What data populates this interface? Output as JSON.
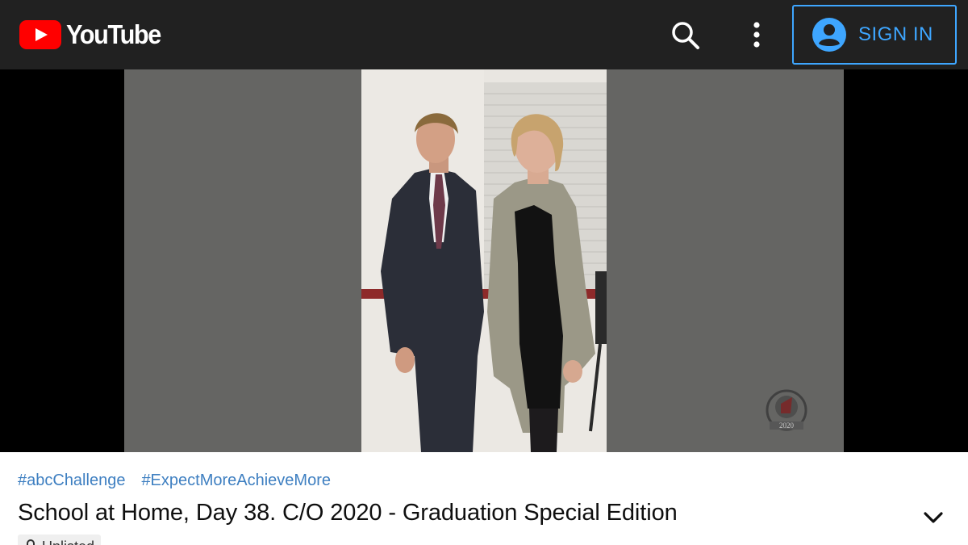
{
  "header": {
    "logo_text": "YouTube",
    "sign_in_label": "SIGN IN",
    "icons": [
      "youtube-logo-icon",
      "search-icon",
      "more-vert-icon",
      "account-circle-icon"
    ],
    "colors": {
      "bar": "#212121",
      "brand": "#ff0000",
      "sign_in": "#3ea6ff"
    }
  },
  "video": {
    "hashtags": [
      "#abcChallenge",
      "#ExpectMoreAchieveMore"
    ],
    "title": "School at Home, Day 38. C/O 2020 - Graduation Special Edition",
    "visibility_label": "Unlisted",
    "watermark_text": "2020"
  }
}
